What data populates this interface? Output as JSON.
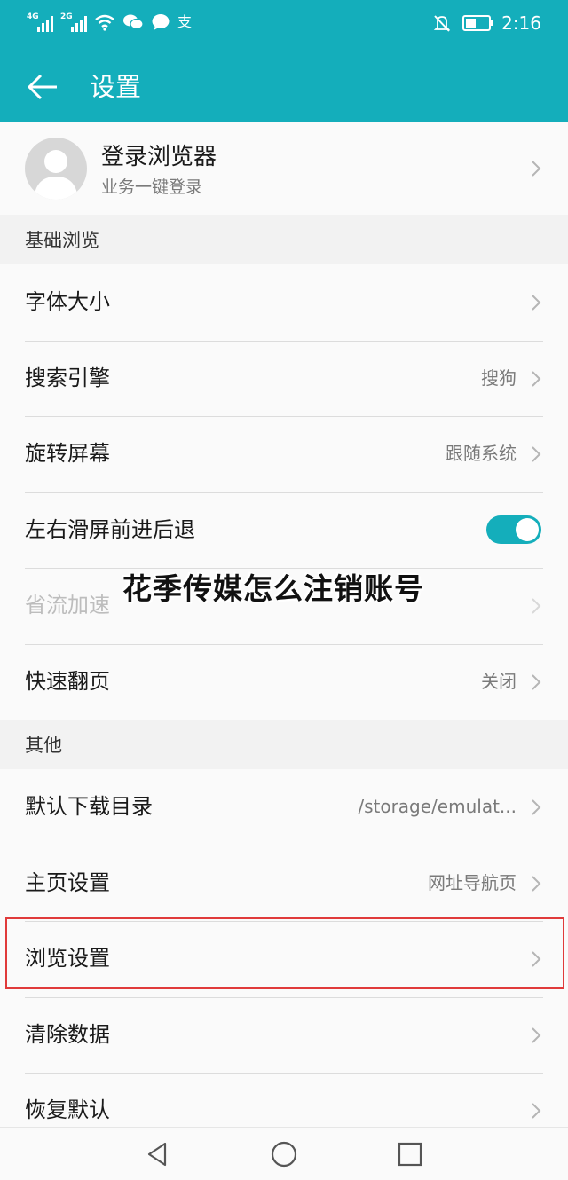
{
  "status_bar": {
    "signal1_label": "4G",
    "signal2_label": "2G",
    "time": "2:16",
    "icons": [
      "signal-icon",
      "signal-icon",
      "wifi-icon",
      "wechat-icon",
      "message-icon",
      "alipay-icon",
      "mute-icon",
      "battery-icon"
    ],
    "battery_level": 0.35
  },
  "app_bar": {
    "title": "设置"
  },
  "login": {
    "title": "登录浏览器",
    "subtitle": "业务一键登录"
  },
  "sections": {
    "basic": {
      "header": "基础浏览",
      "items": [
        {
          "label": "字体大小",
          "value": ""
        },
        {
          "label": "搜索引擎",
          "value": "搜狗"
        },
        {
          "label": "旋转屏幕",
          "value": "跟随系统"
        },
        {
          "label": "左右滑屏前进后退",
          "toggle_on": true
        },
        {
          "label": "省流加速",
          "value": "",
          "disabled": true
        },
        {
          "label": "快速翻页",
          "value": "关闭"
        }
      ]
    },
    "other": {
      "header": "其他",
      "items": [
        {
          "label": "默认下载目录",
          "value": "/storage/emulat..."
        },
        {
          "label": "主页设置",
          "value": "网址导航页"
        },
        {
          "label": "浏览设置",
          "value": "",
          "highlighted": true
        },
        {
          "label": "清除数据",
          "value": ""
        },
        {
          "label": "恢复默认",
          "value": ""
        }
      ]
    }
  },
  "overlay_text": "花季传媒怎么注销账号",
  "colors": {
    "accent": "#14aebb",
    "highlight_border": "#e03a3a"
  }
}
